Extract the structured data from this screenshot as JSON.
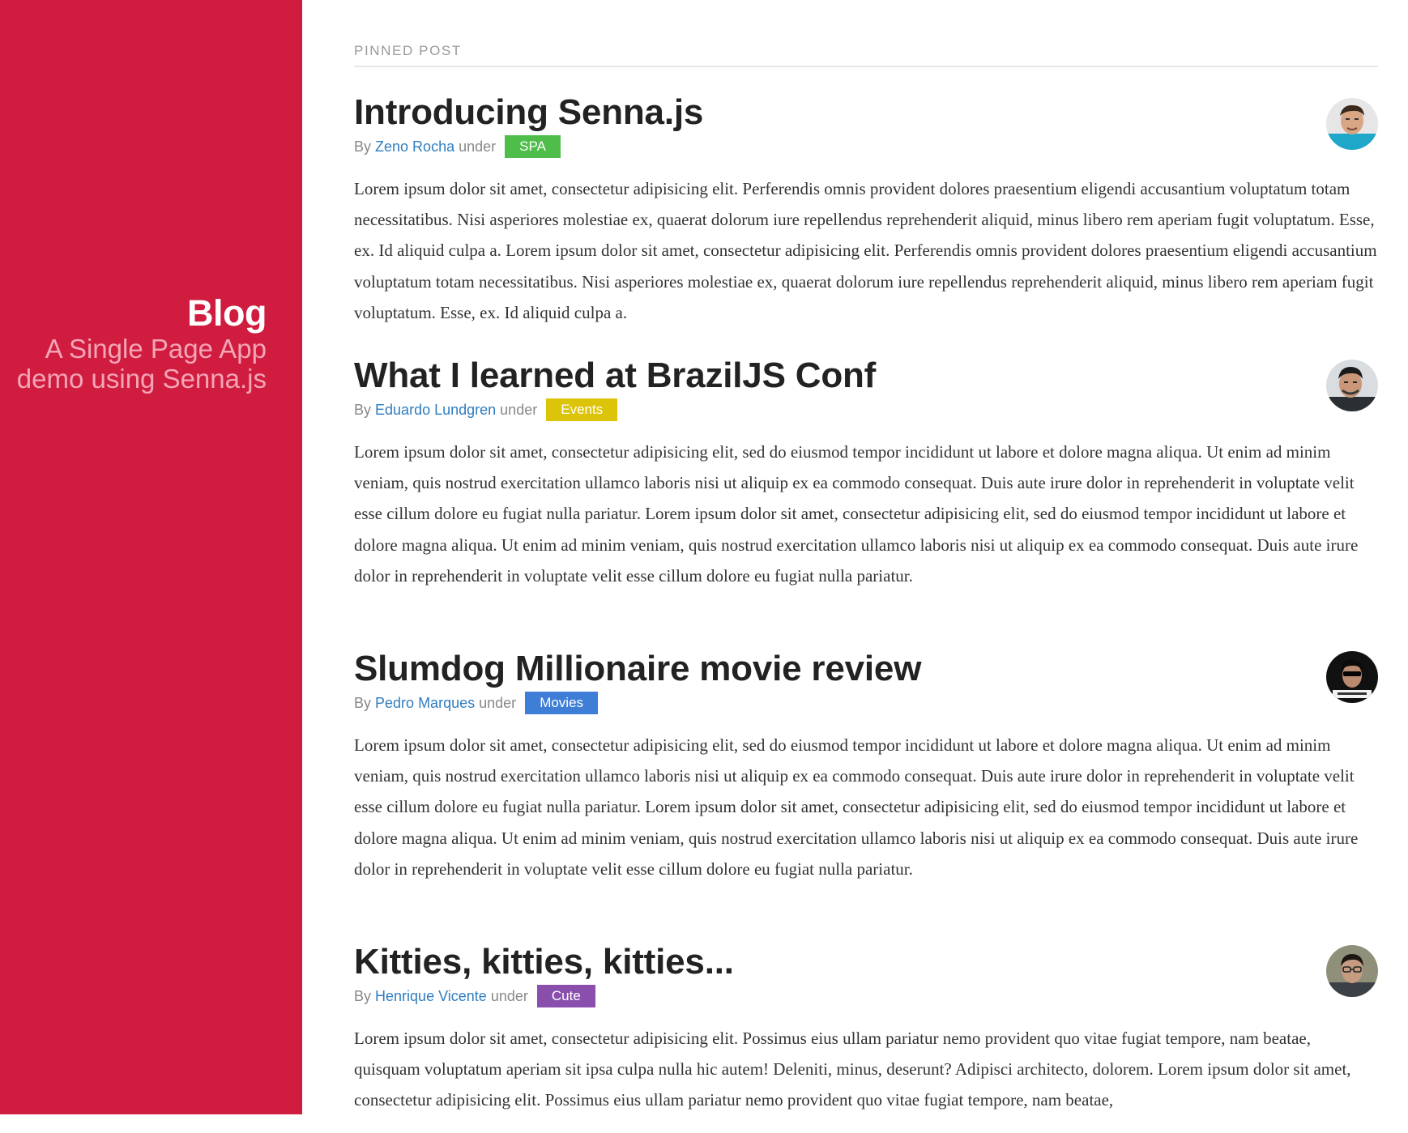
{
  "sidebar": {
    "title": "Blog",
    "subtitle": "A Single Page App demo using Senna.js"
  },
  "section_label": "PINNED POST",
  "posts": [
    {
      "title": "Introducing Senna.js",
      "by": "By",
      "author": "Zeno Rocha",
      "under": "under",
      "tag": "SPA",
      "tag_color": "#4fbd4a",
      "body": "Lorem ipsum dolor sit amet, consectetur adipisicing elit. Perferendis omnis provident dolores praesentium eligendi accusantium voluptatum totam necessitatibus. Nisi asperiores molestiae ex, quaerat dolorum iure repellendus reprehenderit aliquid, minus libero rem aperiam fugit voluptatum. Esse, ex. Id aliquid culpa a. Lorem ipsum dolor sit amet, consectetur adipisicing elit. Perferendis omnis provident dolores praesentium eligendi accusantium voluptatum totam necessitatibus. Nisi asperiores molestiae ex, quaerat dolorum iure repellendus reprehenderit aliquid, minus libero rem aperiam fugit voluptatum. Esse, ex. Id aliquid culpa a."
    },
    {
      "title": "What I learned at BrazilJS Conf",
      "by": "By",
      "author": "Eduardo Lundgren",
      "under": "under",
      "tag": "Events",
      "tag_color": "#dcc40a",
      "body": "Lorem ipsum dolor sit amet, consectetur adipisicing elit, sed do eiusmod tempor incididunt ut labore et dolore magna aliqua. Ut enim ad minim veniam, quis nostrud exercitation ullamco laboris nisi ut aliquip ex ea commodo consequat. Duis aute irure dolor in reprehenderit in voluptate velit esse cillum dolore eu fugiat nulla pariatur. Lorem ipsum dolor sit amet, consectetur adipisicing elit, sed do eiusmod tempor incididunt ut labore et dolore magna aliqua. Ut enim ad minim veniam, quis nostrud exercitation ullamco laboris nisi ut aliquip ex ea commodo consequat. Duis aute irure dolor in reprehenderit in voluptate velit esse cillum dolore eu fugiat nulla pariatur."
    },
    {
      "title": "Slumdog Millionaire movie review",
      "by": "By",
      "author": "Pedro Marques",
      "under": "under",
      "tag": "Movies",
      "tag_color": "#3f7ed6",
      "body": "Lorem ipsum dolor sit amet, consectetur adipisicing elit, sed do eiusmod tempor incididunt ut labore et dolore magna aliqua. Ut enim ad minim veniam, quis nostrud exercitation ullamco laboris nisi ut aliquip ex ea commodo consequat. Duis aute irure dolor in reprehenderit in voluptate velit esse cillum dolore eu fugiat nulla pariatur. Lorem ipsum dolor sit amet, consectetur adipisicing elit, sed do eiusmod tempor incididunt ut labore et dolore magna aliqua. Ut enim ad minim veniam, quis nostrud exercitation ullamco laboris nisi ut aliquip ex ea commodo consequat. Duis aute irure dolor in reprehenderit in voluptate velit esse cillum dolore eu fugiat nulla pariatur."
    },
    {
      "title": "Kitties, kitties, kitties...",
      "by": "By",
      "author": "Henrique Vicente",
      "under": "under",
      "tag": "Cute",
      "tag_color": "#8a4fad",
      "body": "Lorem ipsum dolor sit amet, consectetur adipisicing elit. Possimus eius ullam pariatur nemo provident quo vitae fugiat tempore, nam beatae, quisquam voluptatum aperiam sit ipsa culpa nulla hic autem! Deleniti, minus, deserunt? Adipisci architecto, dolorem. Lorem ipsum dolor sit amet, consectetur adipisicing elit. Possimus eius ullam pariatur nemo provident quo vitae fugiat tempore, nam beatae,"
    }
  ],
  "colors": {
    "sidebar": "#d01c3f",
    "link": "#2f7dc0"
  }
}
